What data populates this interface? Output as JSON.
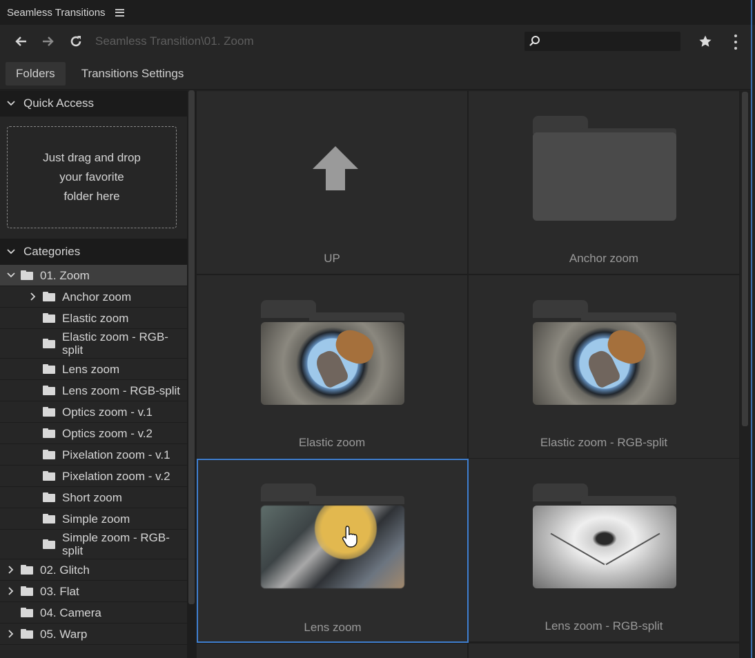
{
  "window": {
    "title": "Seamless Transitions"
  },
  "nav": {
    "path": "Seamless Transition\\01. Zoom",
    "search_placeholder": "",
    "search_value": ""
  },
  "tabs": [
    {
      "label": "Folders",
      "active": true
    },
    {
      "label": "Transitions Settings",
      "active": false
    }
  ],
  "quick_access": {
    "title": "Quick Access",
    "dropzone_lines": [
      "Just drag and drop",
      "your favorite",
      "folder here"
    ]
  },
  "categories": {
    "title": "Categories",
    "items": [
      {
        "label": "01. Zoom",
        "expanded": true,
        "selected": true
      },
      {
        "label": "Anchor zoom",
        "has_children": true
      },
      {
        "label": "Elastic zoom"
      },
      {
        "label": "Elastic zoom - RGB-split"
      },
      {
        "label": "Lens zoom"
      },
      {
        "label": "Lens zoom - RGB-split"
      },
      {
        "label": "Optics zoom - v.1"
      },
      {
        "label": "Optics zoom - v.2"
      },
      {
        "label": "Pixelation zoom - v.1"
      },
      {
        "label": "Pixelation zoom - v.2"
      },
      {
        "label": "Short zoom"
      },
      {
        "label": "Simple zoom"
      },
      {
        "label": "Simple zoom - RGB-split"
      },
      {
        "label": "02. Glitch",
        "has_children": true
      },
      {
        "label": "03. Flat",
        "has_children": true
      },
      {
        "label": "04. Camera"
      },
      {
        "label": "05. Warp",
        "has_children": true
      }
    ]
  },
  "grid": {
    "cells": [
      {
        "name": "UP",
        "kind": "up-arrow"
      },
      {
        "name": "Anchor zoom",
        "kind": "folder"
      },
      {
        "name": "Elastic zoom",
        "kind": "preview-lens"
      },
      {
        "name": "Elastic zoom - RGB-split",
        "kind": "preview-lens"
      },
      {
        "name": "Lens zoom",
        "kind": "preview-blur",
        "selected": true
      },
      {
        "name": "Lens zoom - RGB-split",
        "kind": "preview-tunnel"
      }
    ]
  },
  "colors": {
    "accent": "#3f7fd0",
    "background": "#232323",
    "cursor_glow": "#e2b84f"
  },
  "icons": [
    "menu-icon",
    "back-arrow-icon",
    "forward-arrow-icon",
    "refresh-icon",
    "search-icon",
    "star-icon",
    "more-vert-icon",
    "chevron-down-icon",
    "chevron-right-icon",
    "folder-icon",
    "up-arrow-icon",
    "hand-pointer-icon"
  ]
}
